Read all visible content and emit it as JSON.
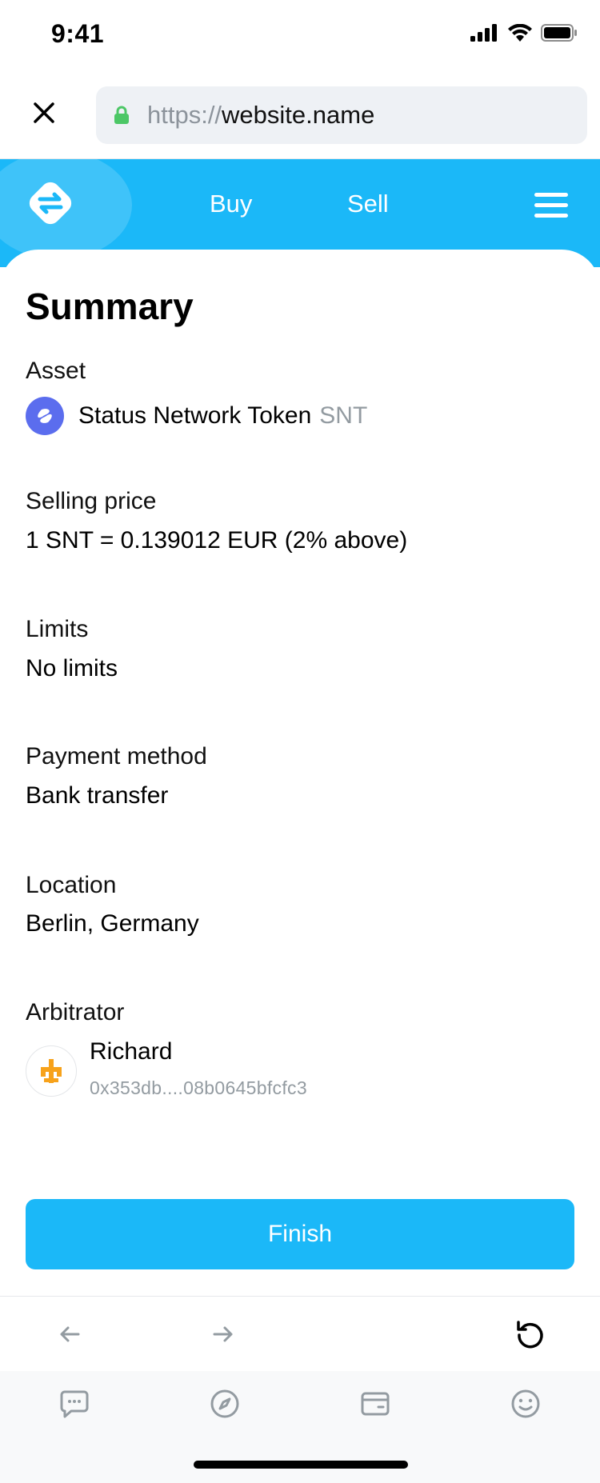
{
  "status_bar": {
    "time": "9:41"
  },
  "browser": {
    "url_scheme": "https://",
    "url_host": "website.name"
  },
  "header": {
    "nav_buy": "Buy",
    "nav_sell": "Sell"
  },
  "summary": {
    "title": "Summary",
    "asset_label": "Asset",
    "asset_name": "Status Network Token",
    "asset_symbol": "SNT",
    "selling_price_label": "Selling price",
    "selling_price_value": "1 SNT = 0.139012 EUR (2% above)",
    "limits_label": "Limits",
    "limits_value": "No limits",
    "payment_method_label": "Payment method",
    "payment_method_value": "Bank transfer",
    "location_label": "Location",
    "location_value": "Berlin, Germany",
    "arbitrator_label": "Arbitrator",
    "arbitrator_name": "Richard",
    "arbitrator_address": "0x353db....08b0645bfcfc3"
  },
  "actions": {
    "finish_label": "Finish"
  },
  "colors": {
    "accent": "#1bb8f8",
    "snt_icon": "#5b6dee",
    "secure_lock": "#4cc766",
    "arbitrator_avatar": "#f7a21b",
    "secondary_text": "#939ba1"
  },
  "icons": {
    "close": "close-icon",
    "lock": "lock-icon",
    "logo": "swap-arrows-logo",
    "menu": "hamburger-menu-icon",
    "back": "arrow-left-icon",
    "forward": "arrow-right-icon",
    "reload": "reload-icon",
    "tabs": [
      "chat-icon",
      "compass-icon",
      "wallet-icon",
      "smiley-icon"
    ]
  }
}
